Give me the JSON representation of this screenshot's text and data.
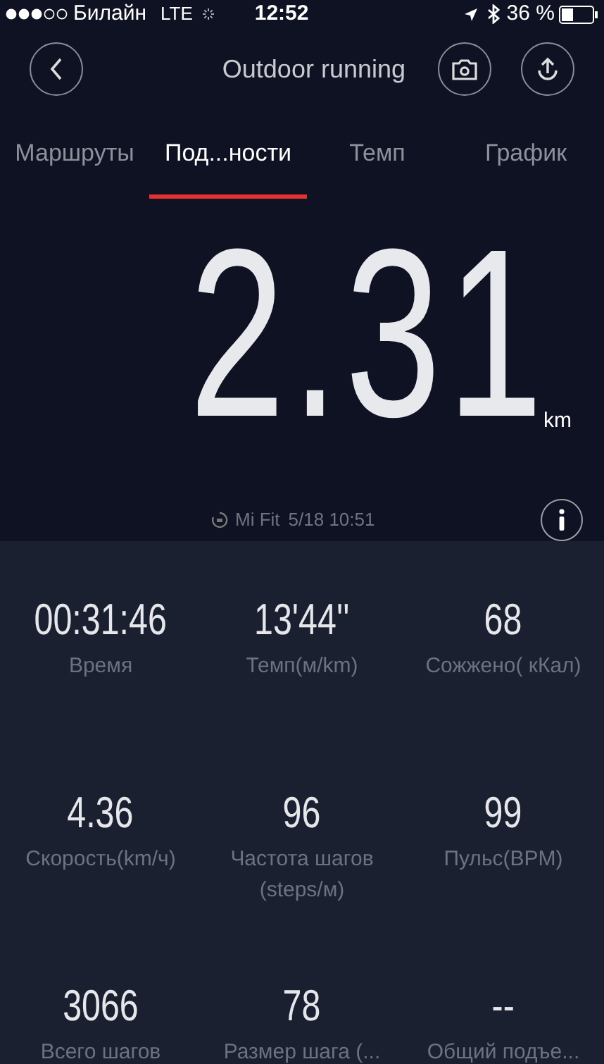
{
  "status_bar": {
    "carrier": "Билайн",
    "network": "LTE",
    "time": "12:52",
    "battery": "36 %"
  },
  "header": {
    "title": "Outdoor running"
  },
  "tabs": [
    {
      "label": "Маршруты",
      "selected": false
    },
    {
      "label": "Под...ности",
      "selected": true
    },
    {
      "label": "Темп",
      "selected": false
    },
    {
      "label": "График",
      "selected": false
    }
  ],
  "summary": {
    "distance": "2.31",
    "unit": "km",
    "source": "Mi Fit",
    "timestamp": "5/18 10:51"
  },
  "stats": [
    {
      "value": "00:31:46",
      "label": "Время"
    },
    {
      "value": "13'44''",
      "label": "Темп(м/km)"
    },
    {
      "value": "68",
      "label": "Сожжено( кКал)"
    },
    {
      "value": "4.36",
      "label": "Скорость(km/ч)"
    },
    {
      "value": "96",
      "label": "Частота шагов (steps/м)"
    },
    {
      "value": "99",
      "label": "Пульс(BPM)"
    },
    {
      "value": "3066",
      "label": "Всего шагов"
    },
    {
      "value": "78",
      "label": "Размер шага (..."
    },
    {
      "value": "--",
      "label": "Общий подъе..."
    }
  ]
}
